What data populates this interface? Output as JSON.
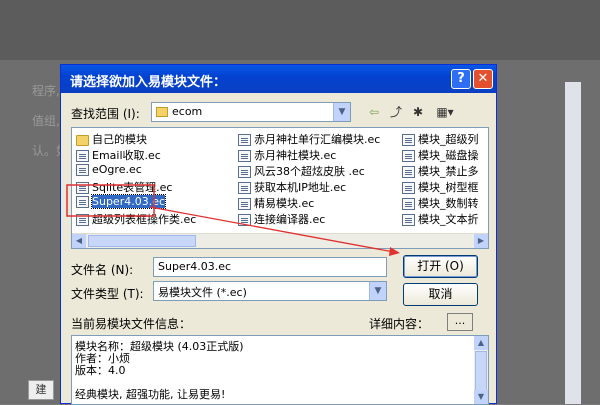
{
  "background": {
    "left_snippets": [
      "程序,",
      "值组,而",
      "认。如"
    ],
    "bottom_tab": "建"
  },
  "dialog": {
    "title": "请选择欲加入易模块文件：",
    "help_label": "?",
    "close_label": "✕",
    "lookin_label": "查找范围 (I):",
    "lookin_value": "ecom",
    "files_col1": [
      {
        "name": "自己的模块",
        "type": "folder"
      },
      {
        "name": "Email收取.ec",
        "type": "file"
      },
      {
        "name": "eOgre.ec",
        "type": "file"
      },
      {
        "name": "Sqlite表管理.ec",
        "type": "file"
      },
      {
        "name": "Super4.03.ec",
        "type": "file",
        "selected": true
      },
      {
        "name": "超级列表框操作类.ec",
        "type": "file"
      }
    ],
    "files_col2": [
      {
        "name": "赤月神社单行汇编模块.ec",
        "type": "file"
      },
      {
        "name": "赤月神社模块.ec",
        "type": "file"
      },
      {
        "name": "风云38个超炫皮肤 .ec",
        "type": "file"
      },
      {
        "name": "获取本机IP地址.ec",
        "type": "file"
      },
      {
        "name": "精易模块.ec",
        "type": "file"
      },
      {
        "name": "连接编译器.ec",
        "type": "file"
      }
    ],
    "files_col3": [
      {
        "name": "模块_超级列",
        "type": "file"
      },
      {
        "name": "模块_磁盘操",
        "type": "file"
      },
      {
        "name": "模块_禁止多",
        "type": "file"
      },
      {
        "name": "模块_树型框",
        "type": "file"
      },
      {
        "name": "模块_数制转",
        "type": "file"
      },
      {
        "name": "模块_文本折",
        "type": "file"
      }
    ],
    "filename_label": "文件名 (N):",
    "filename_value": "Super4.03.ec",
    "filetype_label": "文件类型 (T):",
    "filetype_value": "易模块文件 (*.ec)",
    "open_label": "打开 (O)",
    "cancel_label": "取消",
    "info_label": "当前易模块文件信息：",
    "detail_label": "详细内容：",
    "detail_button": "...",
    "info_lines": [
      "模块名称：超级模块 (4.03正式版)",
      "作者：小烦",
      "版本：4.0",
      "",
      "经典模块, 超强功能, 让易更易!"
    ]
  },
  "colors": {
    "title_bar": "#0a58e6",
    "highlight_box": "#e03030",
    "arrow": "#e03030",
    "selection": "#316ac5"
  }
}
